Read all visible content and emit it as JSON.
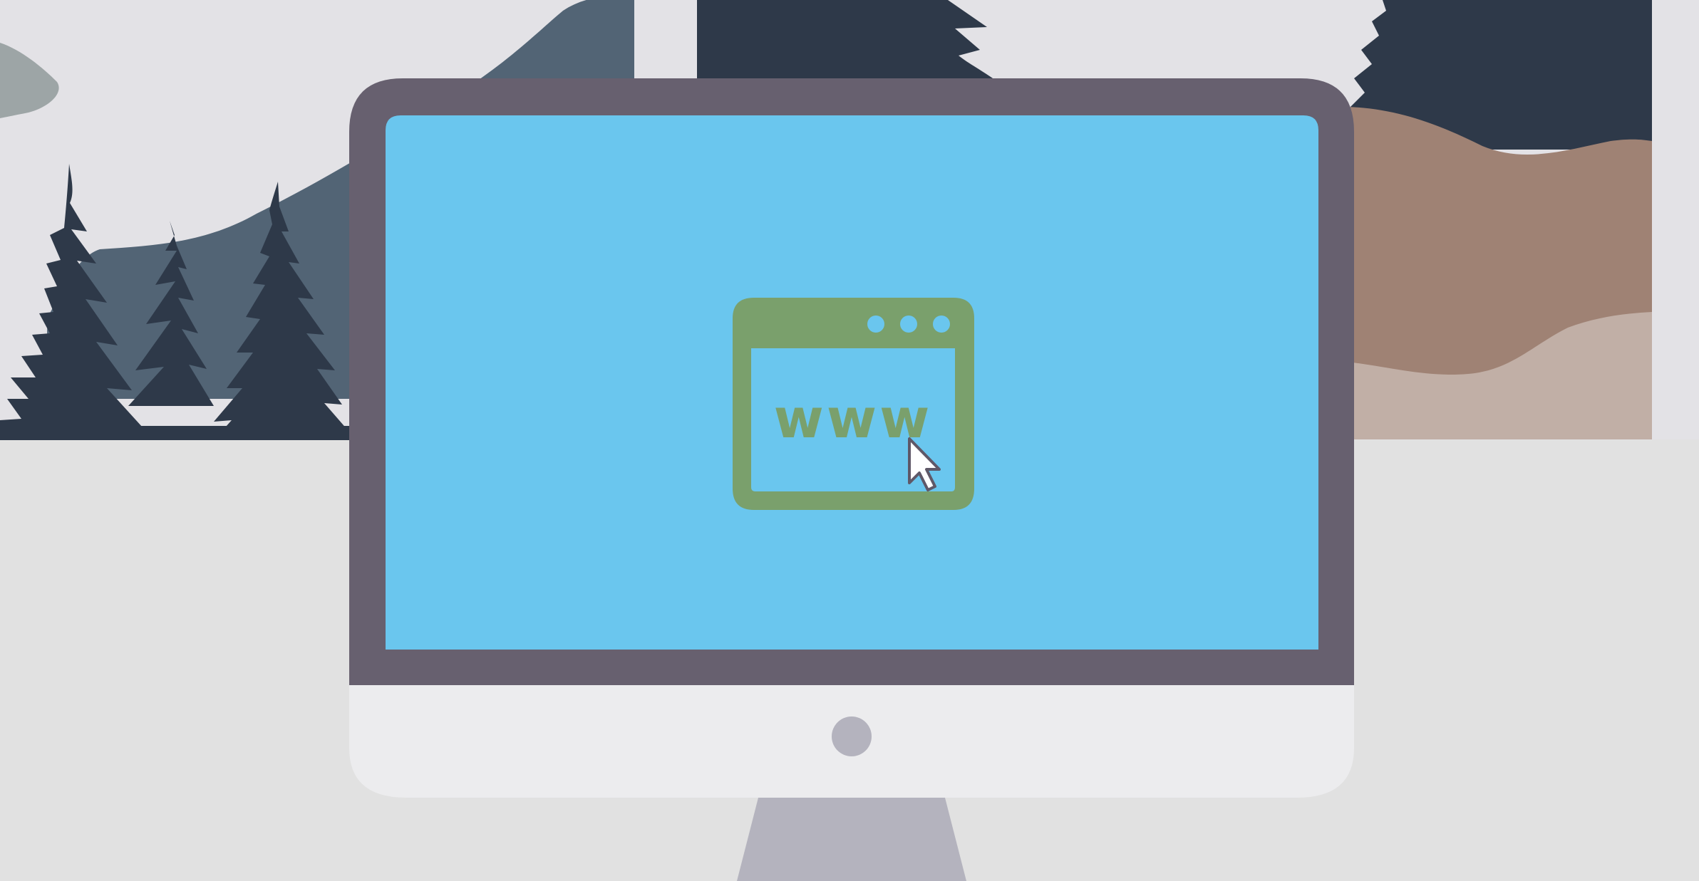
{
  "scene": {
    "subject": "desktop-monitor",
    "browser_icon_text": "www",
    "icons": [
      "browser-window-icon",
      "mouse-cursor-icon",
      "power-button-icon"
    ]
  },
  "colors": {
    "background_top": "#e3e2e6",
    "background_bottom": "#e1e1e1",
    "screen": "#6ac6ee",
    "bezel": "#67606f",
    "chin": "#ececee",
    "stand": "#b4b3be",
    "power_button": "#b4b3be",
    "browser_icon": "#7aa06c",
    "trees": "#2e3949",
    "mountain": "#526475",
    "hill_brown": "#9f8274",
    "hill_tan": "#c1afa6",
    "cloud": "#9da5a6",
    "cursor_fill": "#ffffff",
    "cursor_stroke": "#5f5868"
  }
}
